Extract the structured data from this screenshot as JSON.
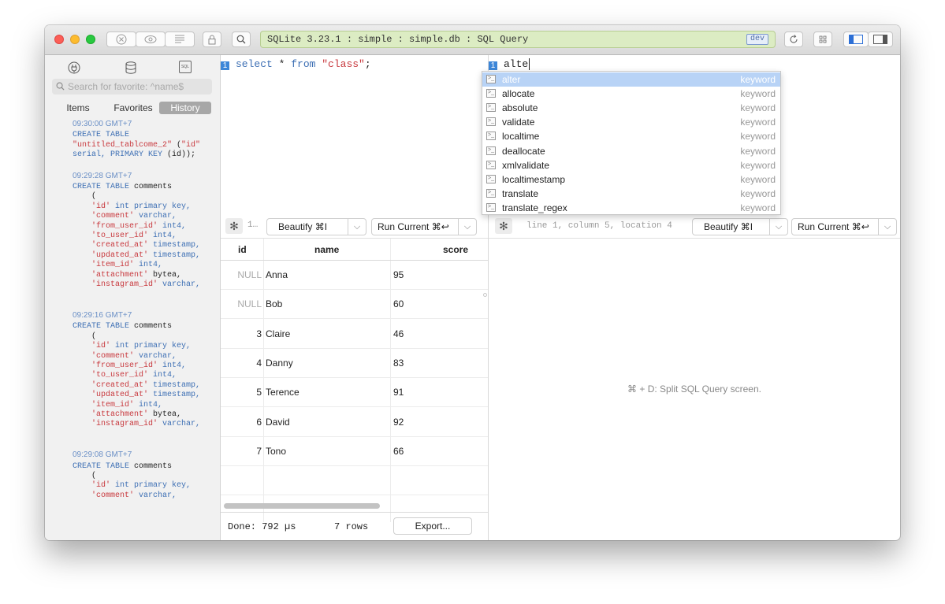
{
  "toolbar": {
    "address_text": "SQLite 3.23.1 : simple : simple.db : SQL Query",
    "dev_badge": "dev"
  },
  "sidebar": {
    "search_placeholder": "Search for favorite: ^name$",
    "db_badge": "SQL",
    "segments": [
      "Items",
      "Favorites",
      "History"
    ],
    "active_segment": "History",
    "history": [
      {
        "time": "09:30:00 GMT+7",
        "lines": [
          [
            {
              "t": "CREATE TABLE",
              "c": "kw"
            }
          ],
          [
            {
              "t": "\"untitled_tablcome_2\"",
              "c": "str"
            },
            {
              "t": " (",
              "c": "plain"
            },
            {
              "t": "\"id\"",
              "c": "str"
            }
          ],
          [
            {
              "t": "serial, PRIMARY KEY",
              "c": "kw"
            },
            {
              "t": " (id));",
              "c": "plain"
            }
          ]
        ]
      },
      {
        "time": "09:29:28 GMT+7",
        "lines": [
          [
            {
              "t": "CREATE TABLE",
              "c": "kw"
            },
            {
              "t": " comments",
              "c": "plain"
            }
          ],
          [
            {
              "t": "    (",
              "c": "plain"
            }
          ],
          [
            {
              "t": "    'id'",
              "c": "str"
            },
            {
              "t": " int primary key,",
              "c": "kw"
            }
          ],
          [
            {
              "t": "    'comment'",
              "c": "str"
            },
            {
              "t": " varchar,",
              "c": "kw"
            }
          ],
          [
            {
              "t": "    'from_user_id'",
              "c": "str"
            },
            {
              "t": " int4,",
              "c": "kw"
            }
          ],
          [
            {
              "t": "    'to_user_id'",
              "c": "str"
            },
            {
              "t": " int4,",
              "c": "kw"
            }
          ],
          [
            {
              "t": "    'created_at'",
              "c": "str"
            },
            {
              "t": " timestamp,",
              "c": "kw"
            }
          ],
          [
            {
              "t": "    'updated_at'",
              "c": "str"
            },
            {
              "t": " timestamp,",
              "c": "kw"
            }
          ],
          [
            {
              "t": "    'item_id'",
              "c": "str"
            },
            {
              "t": " int4,",
              "c": "kw"
            }
          ],
          [
            {
              "t": "    'attachment'",
              "c": "str"
            },
            {
              "t": " bytea,",
              "c": "plain"
            }
          ],
          [
            {
              "t": "    'instagram_id'",
              "c": "str"
            },
            {
              "t": " varchar,",
              "c": "kw"
            }
          ],
          [
            {
              "t": " ",
              "c": "plain"
            }
          ]
        ]
      },
      {
        "time": "09:29:16 GMT+7",
        "lines": [
          [
            {
              "t": "CREATE TABLE",
              "c": "kw"
            },
            {
              "t": " comments",
              "c": "plain"
            }
          ],
          [
            {
              "t": "    (",
              "c": "plain"
            }
          ],
          [
            {
              "t": "    'id'",
              "c": "str"
            },
            {
              "t": " int primary key,",
              "c": "kw"
            }
          ],
          [
            {
              "t": "    'comment'",
              "c": "str"
            },
            {
              "t": " varchar,",
              "c": "kw"
            }
          ],
          [
            {
              "t": "    'from_user_id'",
              "c": "str"
            },
            {
              "t": " int4,",
              "c": "kw"
            }
          ],
          [
            {
              "t": "    'to_user_id'",
              "c": "str"
            },
            {
              "t": " int4,",
              "c": "kw"
            }
          ],
          [
            {
              "t": "    'created_at'",
              "c": "str"
            },
            {
              "t": " timestamp,",
              "c": "kw"
            }
          ],
          [
            {
              "t": "    'updated_at'",
              "c": "str"
            },
            {
              "t": " timestamp,",
              "c": "kw"
            }
          ],
          [
            {
              "t": "    'item_id'",
              "c": "str"
            },
            {
              "t": " int4,",
              "c": "kw"
            }
          ],
          [
            {
              "t": "    'attachment'",
              "c": "str"
            },
            {
              "t": " bytea,",
              "c": "plain"
            }
          ],
          [
            {
              "t": "    'instagram_id'",
              "c": "str"
            },
            {
              "t": " varchar,",
              "c": "kw"
            }
          ],
          [
            {
              "t": " ",
              "c": "plain"
            }
          ]
        ]
      },
      {
        "time": "09:29:08 GMT+7",
        "lines": [
          [
            {
              "t": "CREATE TABLE",
              "c": "kw"
            },
            {
              "t": " comments",
              "c": "plain"
            }
          ],
          [
            {
              "t": "    (",
              "c": "plain"
            }
          ],
          [
            {
              "t": "    'id'",
              "c": "str"
            },
            {
              "t": " int primary key,",
              "c": "kw"
            }
          ],
          [
            {
              "t": "    'comment'",
              "c": "str"
            },
            {
              "t": " varchar,",
              "c": "kw"
            }
          ]
        ]
      }
    ]
  },
  "left_editor": {
    "line_number": "1",
    "code": [
      {
        "t": "select ",
        "c": "kw"
      },
      {
        "t": "* ",
        "c": "plain"
      },
      {
        "t": "from ",
        "c": "kw"
      },
      {
        "t": "\"class\"",
        "c": "str"
      },
      {
        "t": ";",
        "c": "plain"
      }
    ],
    "location_short": "1…",
    "beautify_label": "Beautify ⌘I",
    "run_label": "Run Current ⌘↩"
  },
  "right_editor": {
    "line_number": "1",
    "code_text": "alte",
    "location": "line 1, column 5, location 4",
    "beautify_label": "Beautify ⌘I",
    "run_label": "Run Current ⌘↩",
    "hint": "⌘ + D: Split SQL Query screen."
  },
  "autocomplete": {
    "items": [
      {
        "label": "alter",
        "type": "keyword",
        "selected": true
      },
      {
        "label": "allocate",
        "type": "keyword"
      },
      {
        "label": "absolute",
        "type": "keyword"
      },
      {
        "label": "validate",
        "type": "keyword"
      },
      {
        "label": "localtime",
        "type": "keyword"
      },
      {
        "label": "deallocate",
        "type": "keyword"
      },
      {
        "label": "xmlvalidate",
        "type": "keyword"
      },
      {
        "label": "localtimestamp",
        "type": "keyword"
      },
      {
        "label": "translate",
        "type": "keyword"
      },
      {
        "label": "translate_regex",
        "type": "keyword"
      }
    ]
  },
  "results": {
    "columns": [
      "id",
      "name",
      "score"
    ],
    "rows": [
      {
        "id": "NULL",
        "name": "Anna",
        "score": "95",
        "null": true
      },
      {
        "id": "NULL",
        "name": "Bob",
        "score": "60",
        "null": true
      },
      {
        "id": "3",
        "name": "Claire",
        "score": "46"
      },
      {
        "id": "4",
        "name": "Danny",
        "score": "83"
      },
      {
        "id": "5",
        "name": "Terence",
        "score": "91"
      },
      {
        "id": "6",
        "name": "David",
        "score": "92"
      },
      {
        "id": "7",
        "name": "Tono",
        "score": "66"
      }
    ],
    "status": "Done: 792 µs",
    "row_count": "7 rows",
    "export_label": "Export..."
  }
}
